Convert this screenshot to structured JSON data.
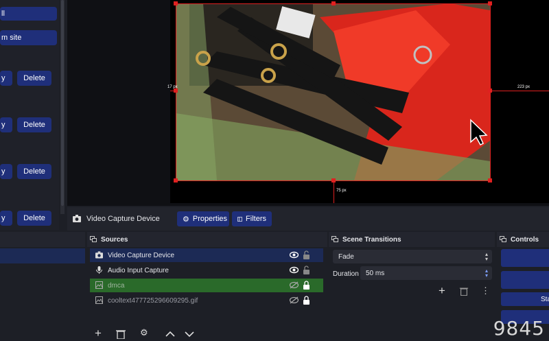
{
  "left_panel": {
    "items": [
      {
        "label": "ll"
      },
      {
        "label": "m site"
      }
    ],
    "rows": [
      {
        "modify_label": "y",
        "delete_label": "Delete"
      },
      {
        "modify_label": "y",
        "delete_label": "Delete"
      },
      {
        "modify_label": "y",
        "delete_label": "Delete"
      },
      {
        "modify_label": "y",
        "delete_label": "Delete"
      }
    ]
  },
  "preview": {
    "dim_left": "17 px",
    "dim_right": "223 px",
    "dim_bottom": "75 px"
  },
  "source_toolbar": {
    "source_name": "Video Capture Device",
    "properties_label": "Properties",
    "filters_label": "Filters"
  },
  "sources": {
    "title": "Sources",
    "items": [
      {
        "name": "Video Capture Device",
        "icon": "camera-icon",
        "visible": true,
        "locked": false
      },
      {
        "name": "Audio Input Capture",
        "icon": "microphone-icon",
        "visible": true,
        "locked": false
      },
      {
        "name": "dmca",
        "icon": "image-icon",
        "visible": false,
        "locked": true,
        "selected": true
      },
      {
        "name": "cooltext477725296609295.gif",
        "icon": "image-icon",
        "visible": false,
        "locked": true
      }
    ]
  },
  "transitions": {
    "title": "Scene Transitions",
    "selected": "Fade",
    "duration_label": "Duration",
    "duration_value": "50 ms"
  },
  "controls": {
    "title": "Controls",
    "partial_label": "Sta"
  },
  "watermark": "9845",
  "colors": {
    "accent": "#1f2f7a",
    "selected_row": "#2a6a2a",
    "highlight_row": "#1c2a55",
    "bounding_box": "#e02020"
  }
}
